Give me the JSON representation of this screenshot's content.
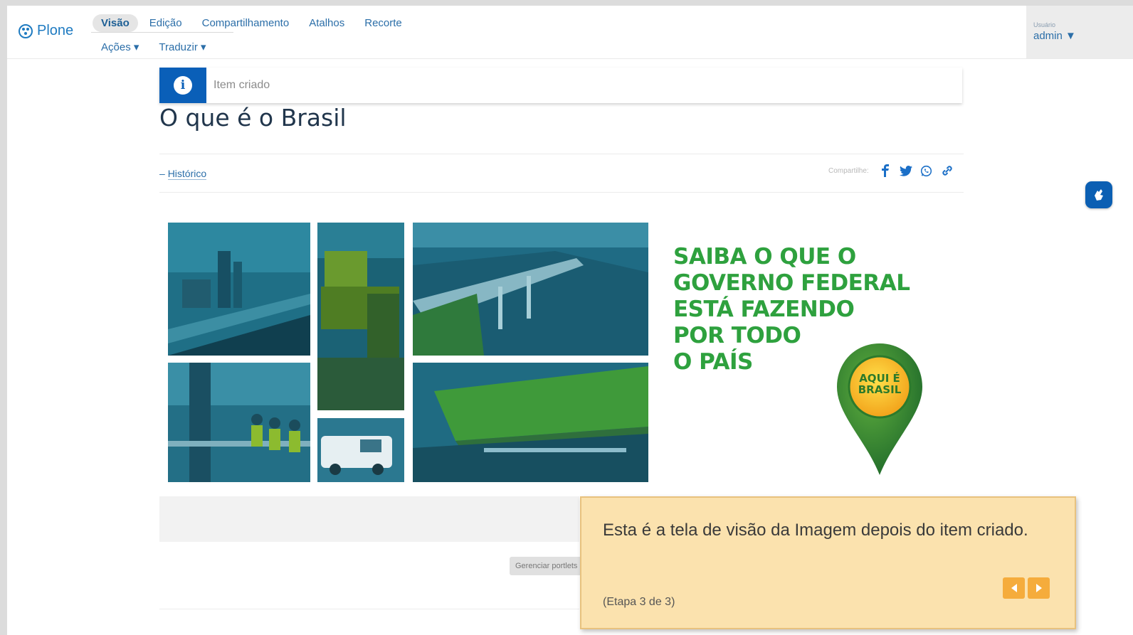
{
  "toolbar": {
    "logo_text": "Plone",
    "nav_row1": [
      "Visão",
      "Edição",
      "Compartilhamento",
      "Atalhos",
      "Recorte"
    ],
    "nav_row2": [
      "Ações ▾",
      "Traduzir ▾"
    ],
    "user_label": "Usuário",
    "user_name": "admin ▼"
  },
  "status_message": {
    "text": "Item criado"
  },
  "page": {
    "title": "O que é o Brasil",
    "history_link": "Histórico",
    "history_prefix": "–",
    "share_label": "Compartilhe:",
    "share_icons": [
      "facebook-icon",
      "twitter-icon",
      "whatsapp-icon",
      "link-icon"
    ],
    "manage_button": "Gerenciar portlets"
  },
  "banner": {
    "headline": [
      "SAIBA O QUE O",
      "GOVERNO FEDERAL",
      "ESTÁ FAZENDO",
      "POR TODO",
      "O PAÍS"
    ],
    "pin_text_line1": "AQUI É",
    "pin_text_line2": "BRASIL"
  },
  "tour": {
    "text": "Esta é a tela de visão da Imagem depois do item criado.",
    "step": "(Etapa 3 de 3)"
  },
  "colors": {
    "accent_blue": "#0a5fb8",
    "headline_green": "#2ea13e",
    "tour_bg": "#fbe2ae",
    "tour_button": "#f5ac3c"
  }
}
